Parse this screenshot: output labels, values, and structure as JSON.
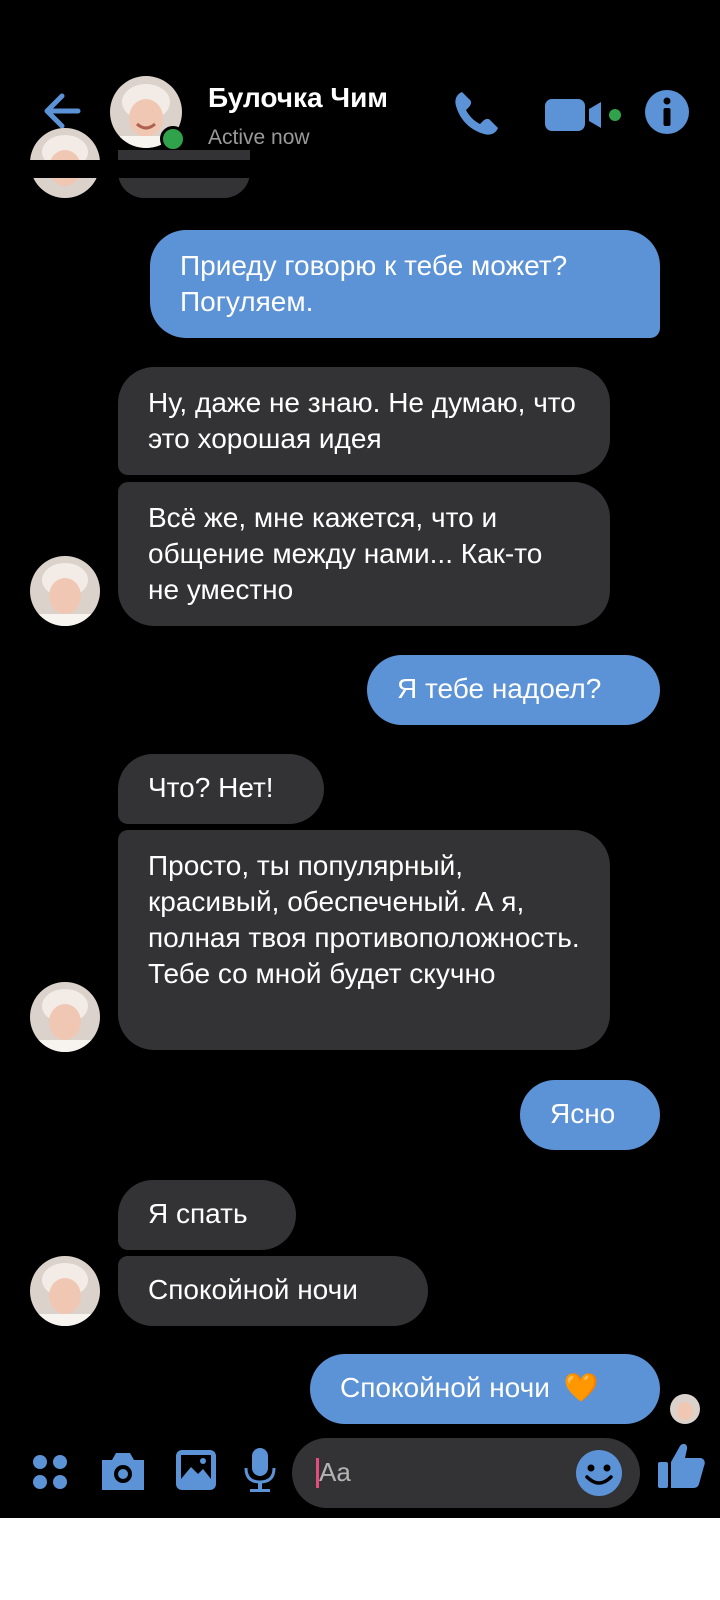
{
  "colors": {
    "accent": "#5c92d6",
    "incoming_bubble": "#333336",
    "background": "#000000",
    "online": "#31a24c"
  },
  "header": {
    "back_icon": "arrow-left-icon",
    "contact_name": "Булочка Чим",
    "status": "Active now",
    "actions": [
      "phone-icon",
      "video-camera-icon",
      "info-icon"
    ]
  },
  "messages": [
    {
      "from": "them",
      "text": ""
    },
    {
      "from": "me",
      "text": "Приеду говорю к тебе может? Погуляем."
    },
    {
      "from": "them",
      "text": "Ну, даже не знаю. Не думаю, что это хорошая идея"
    },
    {
      "from": "them",
      "text": "Всё же, мне кажется, что и общение между нами... Как-то не уместно"
    },
    {
      "from": "me",
      "text": "Я тебе надоел?"
    },
    {
      "from": "them",
      "text": "Что? Нет!"
    },
    {
      "from": "them",
      "text": "Просто, ты популярный, красивый, обеспеченый. А я, полная твоя противоположность. Тебе со мной будет скучно"
    },
    {
      "from": "me",
      "text": "Ясно"
    },
    {
      "from": "them",
      "text": "Я спать"
    },
    {
      "from": "them",
      "text": "Спокойной ночи"
    },
    {
      "from": "me",
      "text": "Спокойной ночи",
      "emoji": "🧡"
    }
  ],
  "composer": {
    "icons": [
      "grid-menu-icon",
      "camera-icon",
      "image-icon",
      "microphone-icon",
      "emoji-icon",
      "thumbs-up-icon"
    ],
    "placeholder": "Aa"
  }
}
